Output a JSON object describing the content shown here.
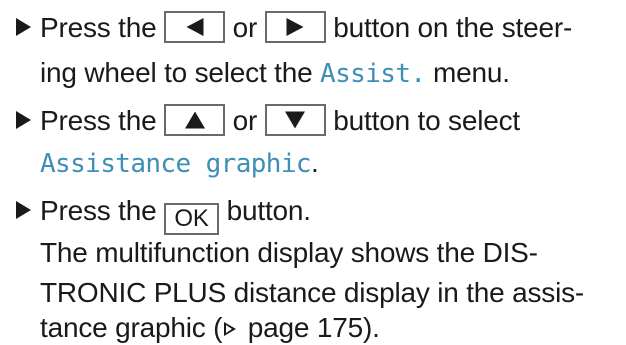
{
  "colors": {
    "text": "#1a1a1a",
    "menu_term": "#3d8fb5",
    "key_border": "#6a6a6a"
  },
  "steps": [
    {
      "text_a": "Press the ",
      "key1_icon": "left-arrow-icon",
      "text_or": " or ",
      "key2_icon": "right-arrow-icon",
      "text_b": " button on the steer-",
      "line2_a": "ing wheel to select the ",
      "menu_term": "Assist.",
      "line2_b": " menu."
    },
    {
      "text_a": "Press the ",
      "key1_icon": "up-arrow-icon",
      "text_or": " or ",
      "key2_icon": "down-arrow-icon",
      "text_b": " button to select",
      "menu_term": "Assistance graphic",
      "line2_b": "."
    },
    {
      "text_a": "Press the ",
      "key_label": "OK",
      "text_b": " button."
    }
  ],
  "result": {
    "line1": "The multifunction display shows the DIS-",
    "line2": "TRONIC PLUS distance display in the assis-",
    "line3_a": "tance graphic (",
    "ref_icon": "page-reference-icon",
    "line3_b": " page 175)."
  }
}
